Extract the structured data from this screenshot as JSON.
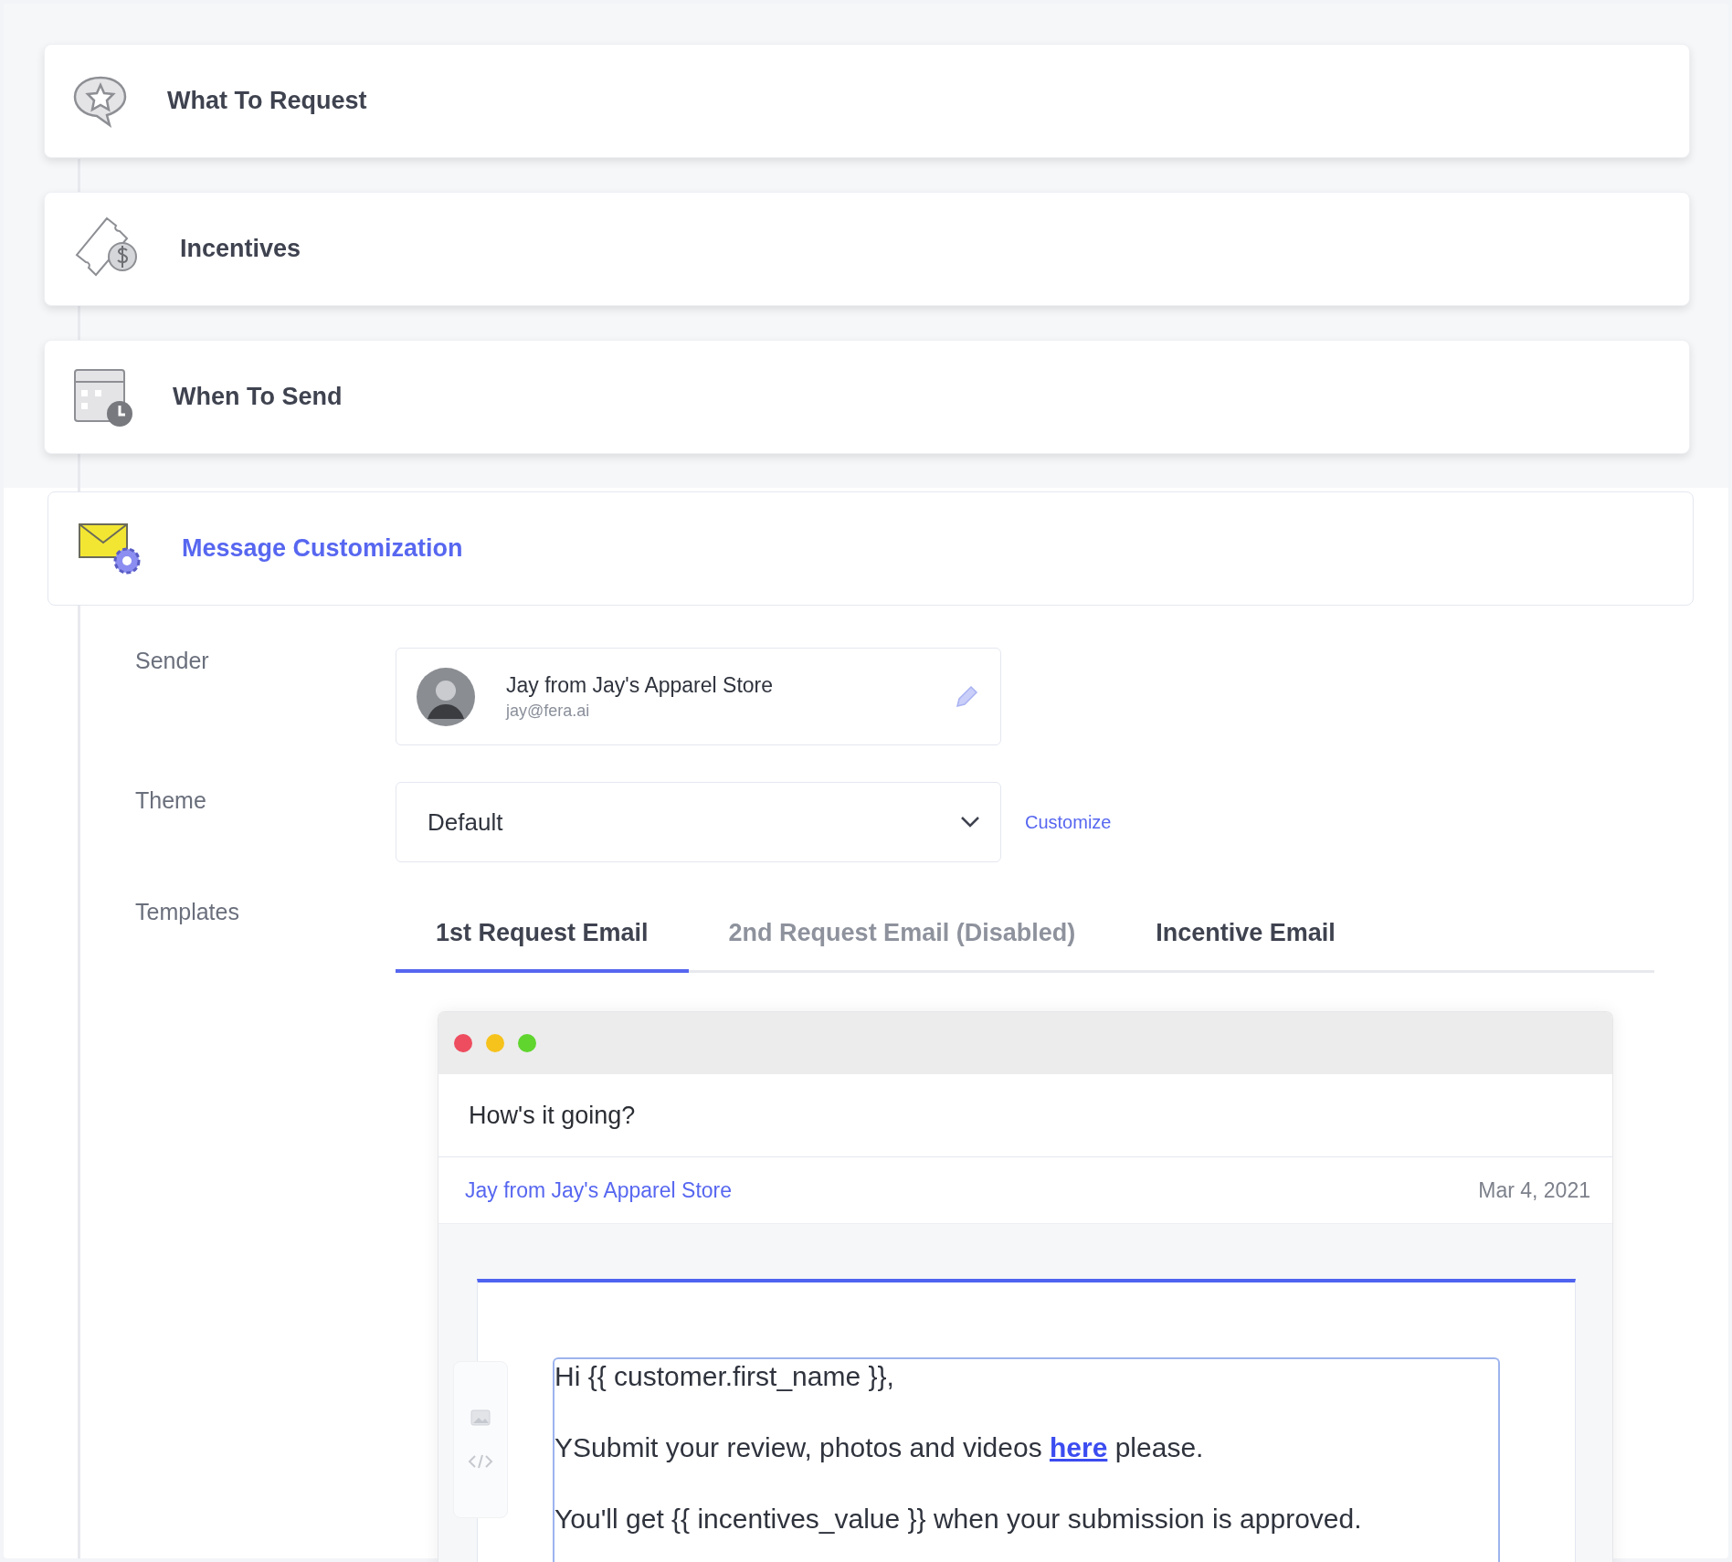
{
  "steps": [
    {
      "title": "What To Request",
      "kind": "request",
      "expanded": false
    },
    {
      "title": "Incentives",
      "kind": "incentives",
      "expanded": false
    },
    {
      "title": "When To Send",
      "kind": "schedule",
      "expanded": false
    },
    {
      "title": "Message Customization",
      "kind": "message",
      "expanded": true
    }
  ],
  "sender": {
    "label": "Sender",
    "name": "Jay from Jay's Apparel Store",
    "email": "jay@fera.ai"
  },
  "theme": {
    "label": "Theme",
    "value": "Default",
    "link": "Customize"
  },
  "templates": {
    "label": "Templates",
    "tabs": [
      {
        "label": "1st Request Email",
        "selected": true,
        "disabled": false
      },
      {
        "label": "2nd Request Email (Disabled)",
        "selected": false,
        "disabled": true
      },
      {
        "label": "Incentive Email",
        "selected": false,
        "disabled": false
      }
    ]
  },
  "preview": {
    "subject": "How's it going?",
    "from": "Jay from Jay's Apparel Store",
    "date": "Mar 4, 2021",
    "body": [
      {
        "text": "Hi {{ customer.first_name }},"
      },
      {
        "before": "YSubmit your review, photos and videos ",
        "link": "here",
        "after": " please."
      },
      {
        "text": "You'll get {{ incentives_value }} when your submission is approved."
      }
    ]
  }
}
